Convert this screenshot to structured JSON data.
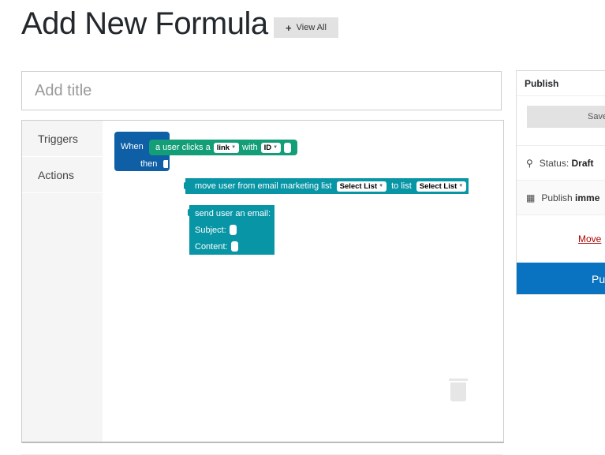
{
  "header": {
    "title": "Add New Formula",
    "view_all_label": "View All",
    "view_all_icon": "plus-icon"
  },
  "title_input": {
    "placeholder": "Add title",
    "value": ""
  },
  "toolbox": {
    "categories": [
      {
        "label": "Triggers"
      },
      {
        "label": "Actions"
      }
    ]
  },
  "blocks": {
    "when": {
      "when_label": "When",
      "then_label": "then",
      "color": "#0e5fa6"
    },
    "trigger": {
      "prefix": "a user clicks a",
      "dropdown1": "link",
      "middle": "with",
      "dropdown2": "ID",
      "color": "#149e78"
    },
    "move": {
      "prefix": "move user from email marketing list",
      "dropdown1": "Select List",
      "middle": "to list",
      "dropdown2": "Select List",
      "color": "#0895a5"
    },
    "email": {
      "title": "send user an email:",
      "subject_label": "Subject:",
      "content_label": "Content:"
    }
  },
  "publish_panel": {
    "heading": "Publish",
    "save_label": "Save",
    "status_label": "Status:",
    "status_value": "Draft",
    "schedule_label": "Publish",
    "schedule_value": "imme",
    "trash_label": "Move",
    "publish_label": "Pu",
    "publish_color": "#0a73c1"
  }
}
